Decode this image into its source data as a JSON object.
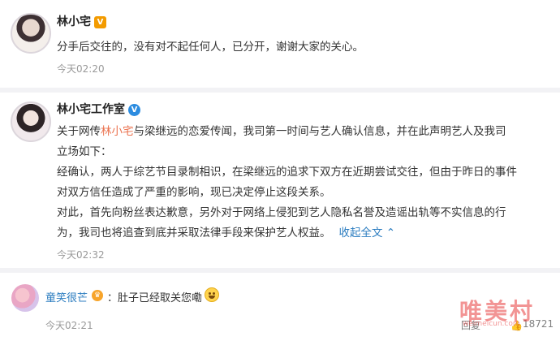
{
  "post1": {
    "author": "林小宅",
    "badge": "V",
    "text": "分手后交往的，没有对不起任何人，已分开，谢谢大家的关心。",
    "time": "今天02:20"
  },
  "post2": {
    "author": "林小宅工作室",
    "badge": "V",
    "l1_pre": "关于网传",
    "l1_mention": "林小宅",
    "l1_post": "与梁继远的恋爱传闻，我司第一时间与艺人确认信息，并在此声明艺人及我司",
    "l2": "立场如下：",
    "l3": "经确认，两人于综艺节目录制相识，在梁继远的追求下双方在近期尝试交往，但由于昨日的事件",
    "l4": "对双方信任造成了严重的影响，现已决定停止这段关系。",
    "l5": "对此，首先向粉丝表达歉意，另外对于网络上侵犯到艺人隐私名誉及造谣出轨等不实信息的行",
    "l6": "为，我司也将追查到底并采取法律手段来保护艺人权益。",
    "collapse": "收起全文",
    "collapse_arrow": "⌃",
    "time": "今天02:32"
  },
  "comment": {
    "user": "童笑很芒",
    "separator": "：",
    "text": "肚子已经取关您嘞",
    "time": "今天02:21",
    "reply": "回复",
    "likes": "18721"
  },
  "watermark": {
    "text": "唯美村",
    "url": "weimeicun.com"
  },
  "colors": {
    "mention": "#eb7350",
    "link": "#2c7dc0",
    "verified_orange": "#f39b00",
    "verified_blue": "#2c8ce0"
  }
}
